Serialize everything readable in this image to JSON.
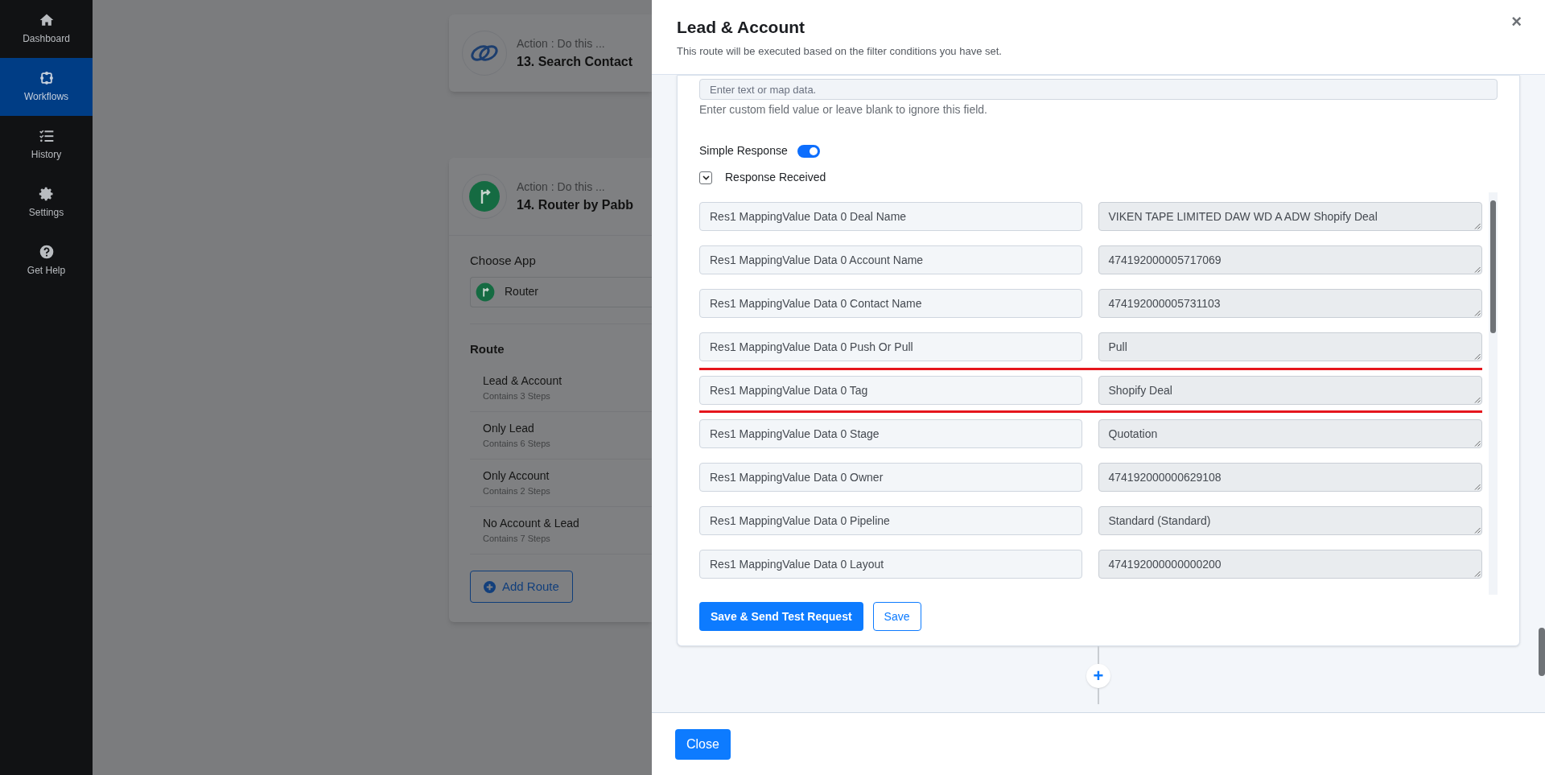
{
  "sidebar": {
    "items": [
      {
        "label": "Dashboard",
        "selected": false
      },
      {
        "label": "Workflows",
        "selected": true
      },
      {
        "label": "History",
        "selected": false
      },
      {
        "label": "Settings",
        "selected": false
      },
      {
        "label": "Get Help",
        "selected": false
      }
    ]
  },
  "background": {
    "steps": [
      {
        "caption": "Action : Do this ...",
        "title": "13. Search Contact"
      },
      {
        "caption": "Action : Do this ...",
        "title": "14. Router by Pabb",
        "choose_app_label": "Choose App",
        "app": "Router",
        "route_heading": "Route",
        "routes": [
          {
            "name": "Lead & Account",
            "steps": "Contains 3 Steps"
          },
          {
            "name": "Only Lead",
            "steps": "Contains 6 Steps"
          },
          {
            "name": "Only Account",
            "steps": "Contains 2 Steps"
          },
          {
            "name": "No Account & Lead",
            "steps": "Contains 7 Steps"
          }
        ],
        "add_button": "Add Route"
      }
    ]
  },
  "panel": {
    "title": "Lead & Account",
    "subtitle": "This route will be executed based on the filter conditions you have set.",
    "close_icon": "×",
    "custom_field": {
      "placeholder": "Enter text or map data.",
      "help": "Enter custom field value or leave blank to ignore this field."
    },
    "simple_response": {
      "label": "Simple Response",
      "on": true
    },
    "response_received": {
      "label": "Response Received",
      "expanded": true
    },
    "rows": [
      {
        "label": "Res1 MappingValue Data 0 Deal Name",
        "value": "VIKEN TAPE LIMITED DAW WD A ADW Shopify Deal",
        "highlighted": false
      },
      {
        "label": "Res1 MappingValue Data 0 Account Name",
        "value": "474192000005717069",
        "highlighted": false
      },
      {
        "label": "Res1 MappingValue Data 0 Contact Name",
        "value": "474192000005731103",
        "highlighted": false
      },
      {
        "label": "Res1 MappingValue Data 0 Push Or Pull",
        "value": "Pull",
        "highlighted": false
      },
      {
        "label": "Res1 MappingValue Data 0 Tag",
        "value": "Shopify Deal",
        "highlighted": true
      },
      {
        "label": "Res1 MappingValue Data 0 Stage",
        "value": "Quotation",
        "highlighted": false
      },
      {
        "label": "Res1 MappingValue Data 0 Owner",
        "value": "474192000000629108",
        "highlighted": false
      },
      {
        "label": "Res1 MappingValue Data 0 Pipeline",
        "value": "Standard (Standard)",
        "highlighted": false
      },
      {
        "label": "Res1 MappingValue Data 0 Layout",
        "value": "474192000000000200",
        "highlighted": false
      }
    ],
    "buttons": [
      "Save & Send Test Request",
      "Save"
    ],
    "add_step_icon": "+",
    "footer_button": "Close"
  }
}
